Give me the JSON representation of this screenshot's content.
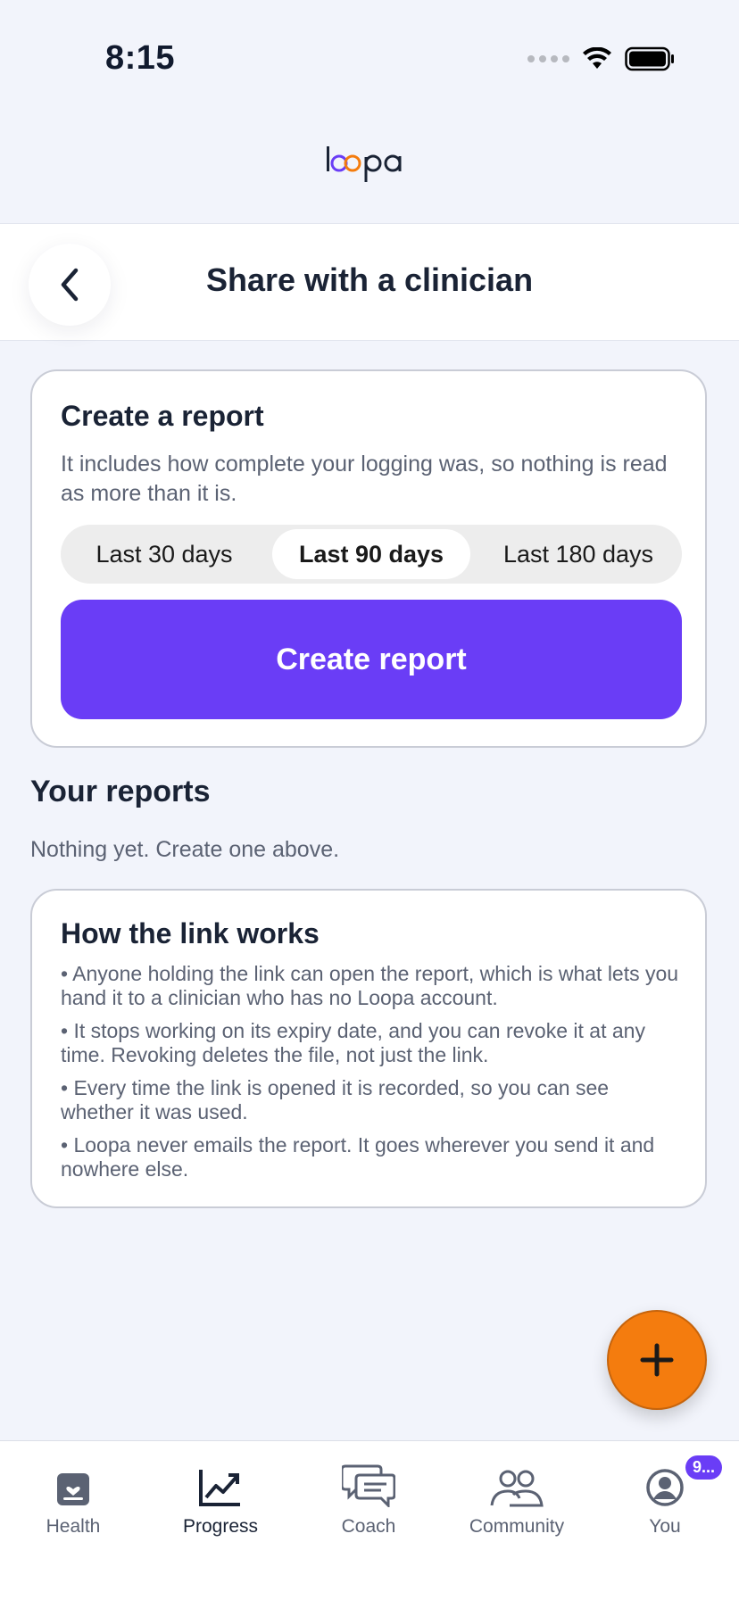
{
  "status_bar": {
    "time": "8:15"
  },
  "brand": {
    "logo_text": "loopa",
    "accent": "#6a3df6"
  },
  "header": {
    "title": "Share with a clinician"
  },
  "create_report": {
    "title": "Create a report",
    "description": "It includes how complete your logging was, so nothing is read as more than it is.",
    "ranges": [
      "Last 30 days",
      "Last 90 days",
      "Last 180 days"
    ],
    "selected_range": "Last 90 days",
    "button_label": "Create report"
  },
  "your_reports": {
    "title": "Your reports",
    "empty_text": "Nothing yet. Create one above."
  },
  "how_link_works": {
    "title": "How the link works",
    "bullets": [
      "• Anyone holding the link can open the report, which is what lets you hand it to a clinician who has no Loopa account.",
      "• It stops working on its expiry date, and you can revoke it at any time. Revoking deletes the file, not just the link.",
      "• Every time the link is opened it is recorded, so you can see whether it was used.",
      "• Loopa never emails the report. It goes wherever you send it and nowhere else."
    ]
  },
  "fab": {
    "icon": "plus-icon",
    "color": "#f47c0e"
  },
  "tab_bar": {
    "items": [
      {
        "label": "Health",
        "icon": "health-icon"
      },
      {
        "label": "Progress",
        "icon": "progress-chart-icon"
      },
      {
        "label": "Coach",
        "icon": "chat-bubbles-icon"
      },
      {
        "label": "Community",
        "icon": "people-icon"
      },
      {
        "label": "You",
        "icon": "user-avatar-icon"
      }
    ],
    "active": "Progress",
    "you_badge": "9..."
  }
}
